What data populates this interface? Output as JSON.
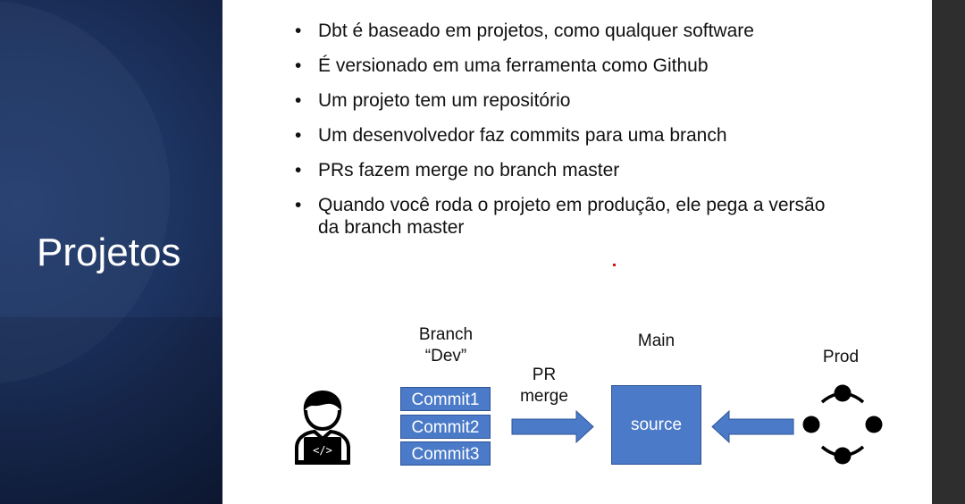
{
  "slide": {
    "title": "Projetos",
    "bullets": [
      "Dbt é baseado em projetos, como qualquer software",
      "É versionado em uma ferramenta como Github",
      "Um projeto tem um repositório",
      "Um desenvolvedor faz commits para uma branch",
      "PRs fazem merge no branch master",
      "Quando você roda o projeto em produção, ele pega a versão da branch master"
    ]
  },
  "diagram": {
    "branch_label_line1": "Branch",
    "branch_label_line2": "“Dev”",
    "commits": [
      "Commit1",
      "Commit2",
      "Commit3"
    ],
    "pr_label_line1": "PR",
    "pr_label_line2": "merge",
    "main_label": "Main",
    "source_label": "source",
    "prod_label": "Prod",
    "developer_icon": "developer-laptop-icon",
    "prod_icon": "deployment-cycle-icon",
    "colors": {
      "box_fill": "#4a7ac8",
      "box_border": "#2f5597",
      "title_panel": "#1d3361"
    }
  }
}
